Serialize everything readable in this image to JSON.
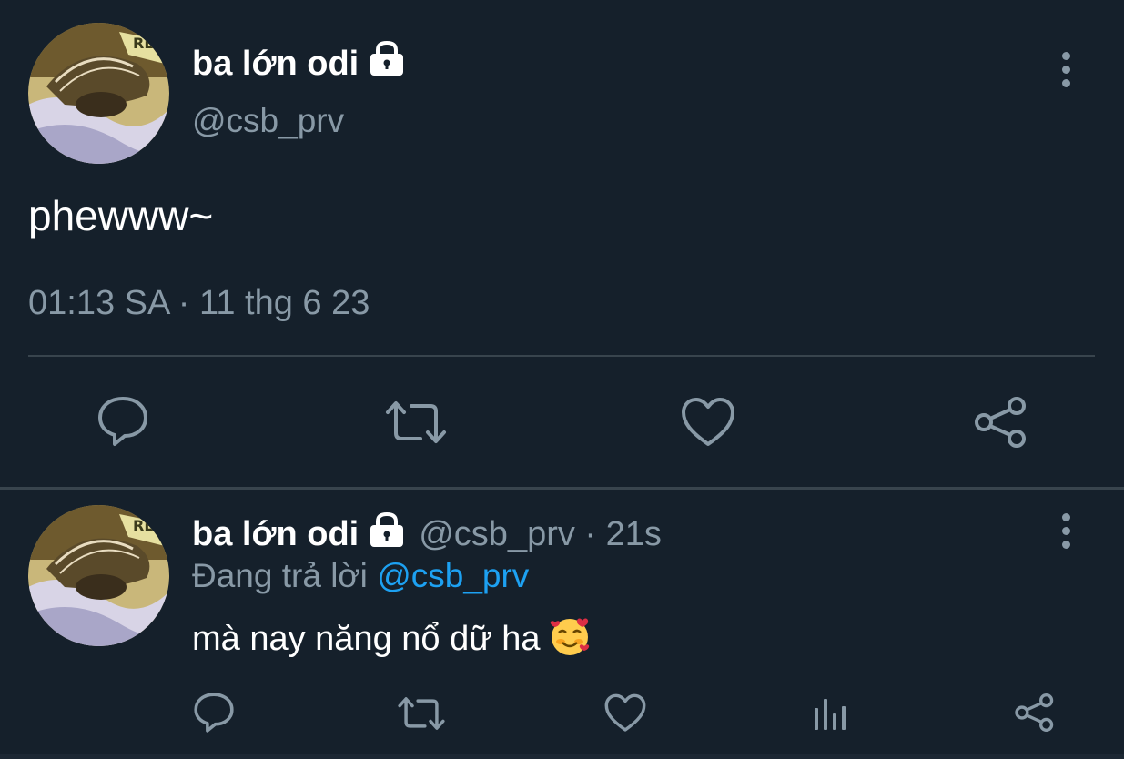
{
  "main_tweet": {
    "display_name": "ba lớn odi",
    "handle": "@csb_prv",
    "text": "phewww~",
    "timestamp": "01:13 SA · 11 thg 6 23"
  },
  "reply_tweet": {
    "display_name": "ba lớn odi",
    "meta": "@csb_prv · 21s",
    "replying_prefix": "Đang trả lời",
    "replying_mention": "@csb_prv",
    "text": "mà nay năng nổ dữ ha"
  },
  "icons": {
    "lock": "lock-icon",
    "more": "more-vertical-icon",
    "reply": "reply-icon",
    "retweet": "retweet-icon",
    "like": "heart-icon",
    "share": "share-icon",
    "analytics": "analytics-icon",
    "emoji": "smiling-face-with-hearts-emoji"
  },
  "colors": {
    "background": "#15202b",
    "secondary_text": "#8899a6",
    "accent": "#1da1f2",
    "divider": "#38444d"
  }
}
